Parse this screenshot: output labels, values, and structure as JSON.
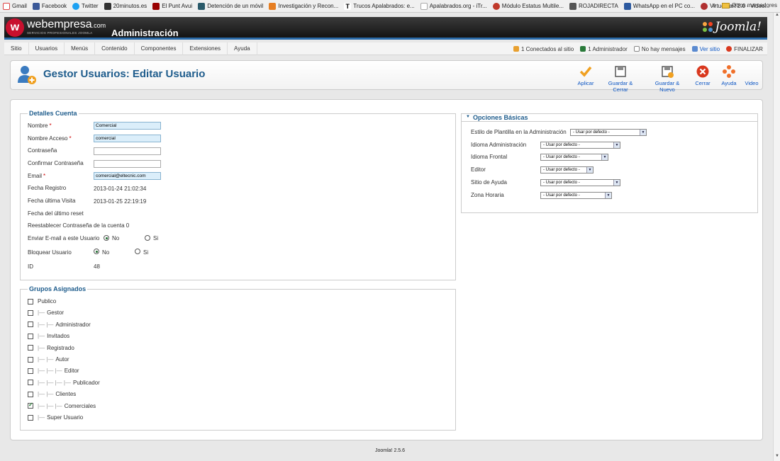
{
  "bookmarks": [
    {
      "label": "Gmail",
      "color": "#d44"
    },
    {
      "label": "Facebook",
      "color": "#3b5998"
    },
    {
      "label": "Twitter",
      "color": "#1da1f2"
    },
    {
      "label": "20minutos.es",
      "color": "#333"
    },
    {
      "label": "El Punt Avui",
      "color": "#900"
    },
    {
      "label": "Detención de un móvil",
      "color": "#2a5a6a"
    },
    {
      "label": "Investigación y Recon...",
      "color": "#e67e22"
    },
    {
      "label": "Trucos Apalabrados: e...",
      "color": "#444"
    },
    {
      "label": "Apalabrados.org - iTr...",
      "color": "#bbb"
    },
    {
      "label": "Módulo Estatus Multile...",
      "color": "#c0392b"
    },
    {
      "label": "ROJADIRECTA",
      "color": "#555"
    },
    {
      "label": "WhatsApp en el PC co...",
      "color": "#2d5aa0"
    },
    {
      "label": "VirtueMart 2.0 - Video...",
      "color": "#b03030"
    }
  ],
  "bookmarks_overflow": "»",
  "other_bookmarks": "Otros marcadores",
  "header": {
    "logo_text": "webempresa",
    "logo_suffix": ".com",
    "logo_sub": "SERVICIOS PROFESIONALES JOOMLA",
    "title": "Administración",
    "brand": "Joomla!"
  },
  "menu": [
    "Sitio",
    "Usuarios",
    "Menús",
    "Contenido",
    "Componentes",
    "Extensiones",
    "Ayuda"
  ],
  "status": {
    "connected": "1 Conectados al sitio",
    "admins": "1 Administrador",
    "messages": "No hay mensajes",
    "view_site": "Ver sitio",
    "logout": "FINALIZAR"
  },
  "toolbar": {
    "title": "Gestor Usuarios: Editar Usuario",
    "buttons": {
      "apply": "Aplicar",
      "save_close": "Guardar & Cerrar",
      "save_new": "Guardar & Nuevo",
      "close": "Cerrar",
      "help": "Ayuda",
      "video": "Video"
    }
  },
  "account": {
    "legend": "Detalles Cuenta",
    "name_label": "Nombre",
    "name_value": "Comercial",
    "username_label": "Nombre Acceso",
    "username_value": "comercial",
    "password_label": "Contraseña",
    "confirm_label": "Confirmar Contraseña",
    "email_label": "Email",
    "email_value": "comercial@eltecnic.com",
    "required_mark": "*",
    "register_label": "Fecha Registro",
    "register_value": "2013-01-24 21:02:34",
    "last_visit_label": "Fecha última Visita",
    "last_visit_value": "2013-01-25 22:19:19",
    "last_reset_label": "Fecha del último reset",
    "reset_count_label": "Reestablecer Contraseña de la cuenta",
    "reset_count_value": "0",
    "send_email_label": "Enviar E-mail a este Usuario",
    "block_label": "Bloquear Usuario",
    "no": "No",
    "yes": "Si",
    "id_label": "ID",
    "id_value": "48"
  },
  "groups": {
    "legend": "Grupos Asignados",
    "items": [
      {
        "label": "Publico",
        "tree": "",
        "checked": false
      },
      {
        "label": "Gestor",
        "tree": "|—",
        "checked": false
      },
      {
        "label": "Administrador",
        "tree": "|— |—",
        "checked": false
      },
      {
        "label": "Invitados",
        "tree": "|—",
        "checked": false
      },
      {
        "label": "Registrado",
        "tree": "|—",
        "checked": false
      },
      {
        "label": "Autor",
        "tree": "|— |—",
        "checked": false
      },
      {
        "label": "Editor",
        "tree": "|— |— |—",
        "checked": false
      },
      {
        "label": "Publicador",
        "tree": "|— |— |— |—",
        "checked": false
      },
      {
        "label": "Clientes",
        "tree": "|— |—",
        "checked": false
      },
      {
        "label": "Comerciales",
        "tree": "|— |— |—",
        "checked": true
      },
      {
        "label": "Super Usuario",
        "tree": "|—",
        "checked": false
      }
    ]
  },
  "basic": {
    "legend": "Opciones Básicas",
    "toggle": "▼",
    "default_option": "- Usar por defecto -",
    "fields": [
      {
        "label": "Estilo de Plantilla en la Administración"
      },
      {
        "label": "Idioma Administración"
      },
      {
        "label": "Idioma Frontal"
      },
      {
        "label": "Editor"
      },
      {
        "label": "Sitio de Ayuda"
      },
      {
        "label": "Zona Horaria"
      }
    ]
  },
  "footer": "Joomla! 2.5.6",
  "colors": {
    "accent": "#1e5c8c",
    "header_bar": "#2a6aa8",
    "apply": "#f0a020",
    "close": "#d9381e"
  }
}
